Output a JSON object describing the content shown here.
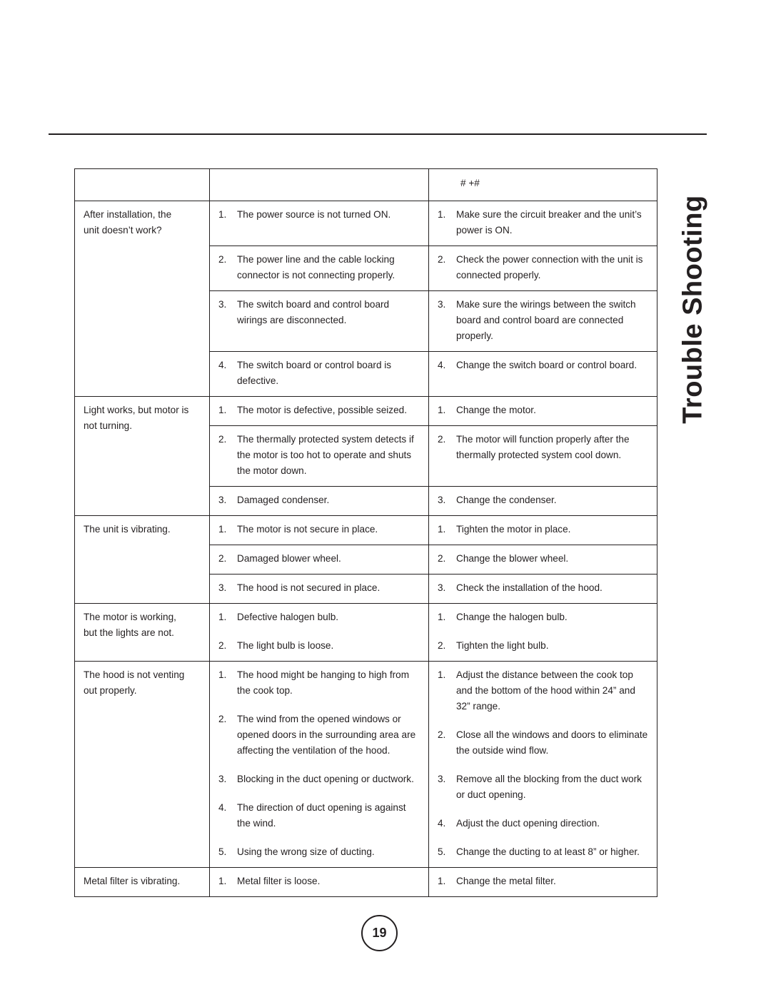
{
  "page": {
    "side_title": "Trouble Shooting",
    "page_number": "19",
    "ink_color": "#231f20"
  },
  "table": {
    "header": {
      "problem": "",
      "cause": "",
      "solution": "# +#"
    },
    "sections": [
      {
        "problem": "After installation, the\nunit doesn’t work?",
        "spaced": false,
        "rows": [
          {
            "cause_num": "1.",
            "cause": "The power source is not turned ON.",
            "solution_num": "1.",
            "solution": "Make sure the circuit breaker and the unit’s power is ON."
          },
          {
            "cause_num": "2.",
            "cause": "The power line and the cable locking connector is not connecting properly.",
            "solution_num": "2.",
            "solution": "Check the power connection with the unit is connected properly."
          },
          {
            "cause_num": "3.",
            "cause": "The switch board and control board wirings are disconnected.",
            "solution_num": "3.",
            "solution": "Make sure the wirings between the switch board and control board are connected properly."
          },
          {
            "cause_num": "4.",
            "cause": "The switch board or control board is defective.",
            "solution_num": "4.",
            "solution": "Change the switch board or control board."
          }
        ]
      },
      {
        "problem": "Light works, but motor is\nnot turning.",
        "spaced": false,
        "rows": [
          {
            "cause_num": "1.",
            "cause": "The motor is defective, possible seized.",
            "solution_num": "1.",
            "solution": "Change the motor."
          },
          {
            "cause_num": "2.",
            "cause": "The thermally protected system detects if the motor is too hot to operate and shuts the motor down.",
            "solution_num": "2.",
            "solution": "The motor will function properly after the thermally protected system cool down."
          },
          {
            "cause_num": "3.",
            "cause": "Damaged condenser.",
            "solution_num": "3.",
            "solution": "Change the condenser."
          }
        ]
      },
      {
        "problem": "The unit is vibrating.",
        "spaced": false,
        "rows": [
          {
            "cause_num": "1.",
            "cause": "The motor is not secure in place.",
            "solution_num": "1.",
            "solution": "Tighten the motor in place."
          },
          {
            "cause_num": "2.",
            "cause": "Damaged blower wheel.",
            "solution_num": "2.",
            "solution": "Change the blower wheel."
          },
          {
            "cause_num": "3.",
            "cause": "The hood is not secured in place.",
            "solution_num": "3.",
            "solution": "Check the installation of the hood."
          }
        ]
      },
      {
        "problem": "The motor is working,\nbut the lights are not.",
        "spaced": true,
        "rows": [
          {
            "cause_num": "1.",
            "cause": "Defective halogen bulb.",
            "solution_num": "1.",
            "solution": "Change the halogen bulb."
          },
          {
            "cause_num": "2.",
            "cause": "The light bulb is loose.",
            "solution_num": "2.",
            "solution": "Tighten the light bulb."
          }
        ]
      },
      {
        "problem": "The hood is not venting\nout properly.",
        "spaced": true,
        "rows": [
          {
            "cause_num": "1.",
            "cause": "The hood might be hanging to high from the cook top.",
            "solution_num": "1.",
            "solution": "Adjust the distance between the cook top and the bottom of the hood within 24” and 32” range."
          },
          {
            "cause_num": "2.",
            "cause": "The wind from the opened windows or opened doors in the surrounding area are affecting the ventilation of the hood.",
            "solution_num": "2.",
            "solution": "Close all the windows and doors to eliminate the outside wind flow."
          },
          {
            "cause_num": "3.",
            "cause": "Blocking in the duct opening or ductwork.",
            "solution_num": "3.",
            "solution": "Remove all the blocking from the duct work or duct opening."
          },
          {
            "cause_num": "4.",
            "cause": "The direction of duct opening is against the wind.",
            "solution_num": "4.",
            "solution": "Adjust the duct opening direction."
          },
          {
            "cause_num": "5.",
            "cause": "Using the wrong size of ducting.",
            "solution_num": "5.",
            "solution": "Change the ducting to at least 8” or higher."
          }
        ]
      },
      {
        "problem": "Metal filter is vibrating.",
        "spaced": true,
        "rows": [
          {
            "cause_num": "1.",
            "cause": "Metal filter is loose.",
            "solution_num": "1.",
            "solution": "Change the metal filter."
          }
        ]
      }
    ]
  }
}
